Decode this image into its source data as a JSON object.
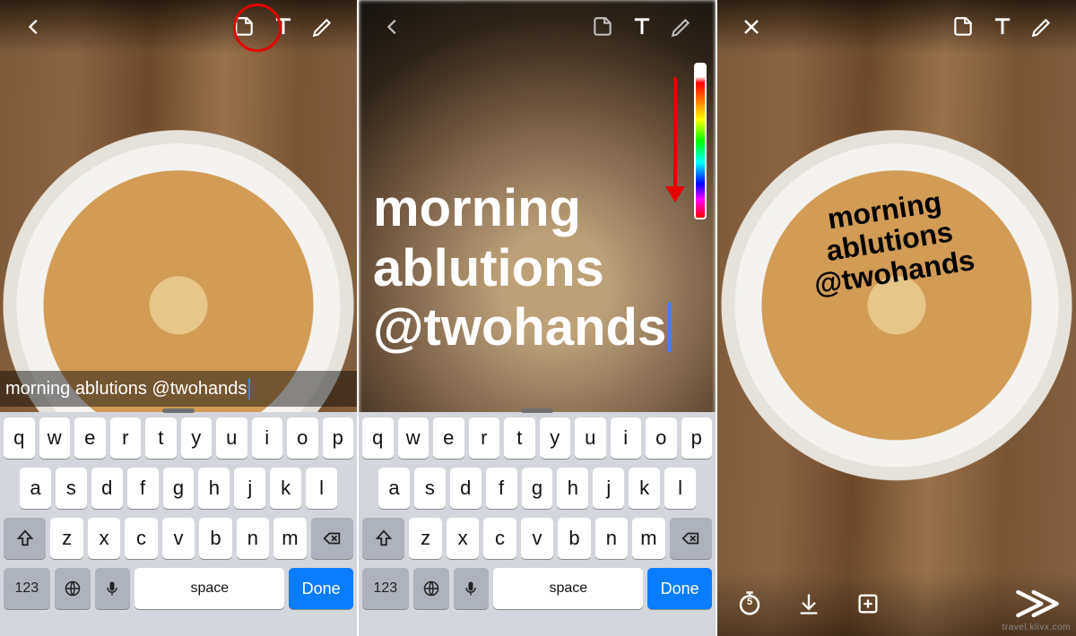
{
  "caption_text": "morning ablutions @twohands",
  "panel1": {
    "topbar_icons": [
      "back",
      "sticker",
      "text",
      "draw"
    ],
    "highlight": "text"
  },
  "panel2": {
    "big_text_lines": [
      "morning",
      "ablutions",
      "@twohands"
    ],
    "topbar_icons": [
      "back",
      "sticker",
      "text",
      "draw"
    ]
  },
  "panel3": {
    "placed_text_lines": [
      "morning",
      "ablutions",
      "@twohands"
    ],
    "topbar_icons": [
      "close",
      "sticker",
      "text",
      "draw"
    ],
    "bottom_icons": [
      "timer-5",
      "save",
      "story",
      "send"
    ]
  },
  "timer_value": "5",
  "keyboard": {
    "rows": [
      [
        "q",
        "w",
        "e",
        "r",
        "t",
        "y",
        "u",
        "i",
        "o",
        "p"
      ],
      [
        "a",
        "s",
        "d",
        "f",
        "g",
        "h",
        "j",
        "k",
        "l"
      ],
      [
        "z",
        "x",
        "c",
        "v",
        "b",
        "n",
        "m"
      ]
    ],
    "numeric_label": "123",
    "space_label": "space",
    "done_label": "Done"
  },
  "watermark": "travel.klivx.com"
}
